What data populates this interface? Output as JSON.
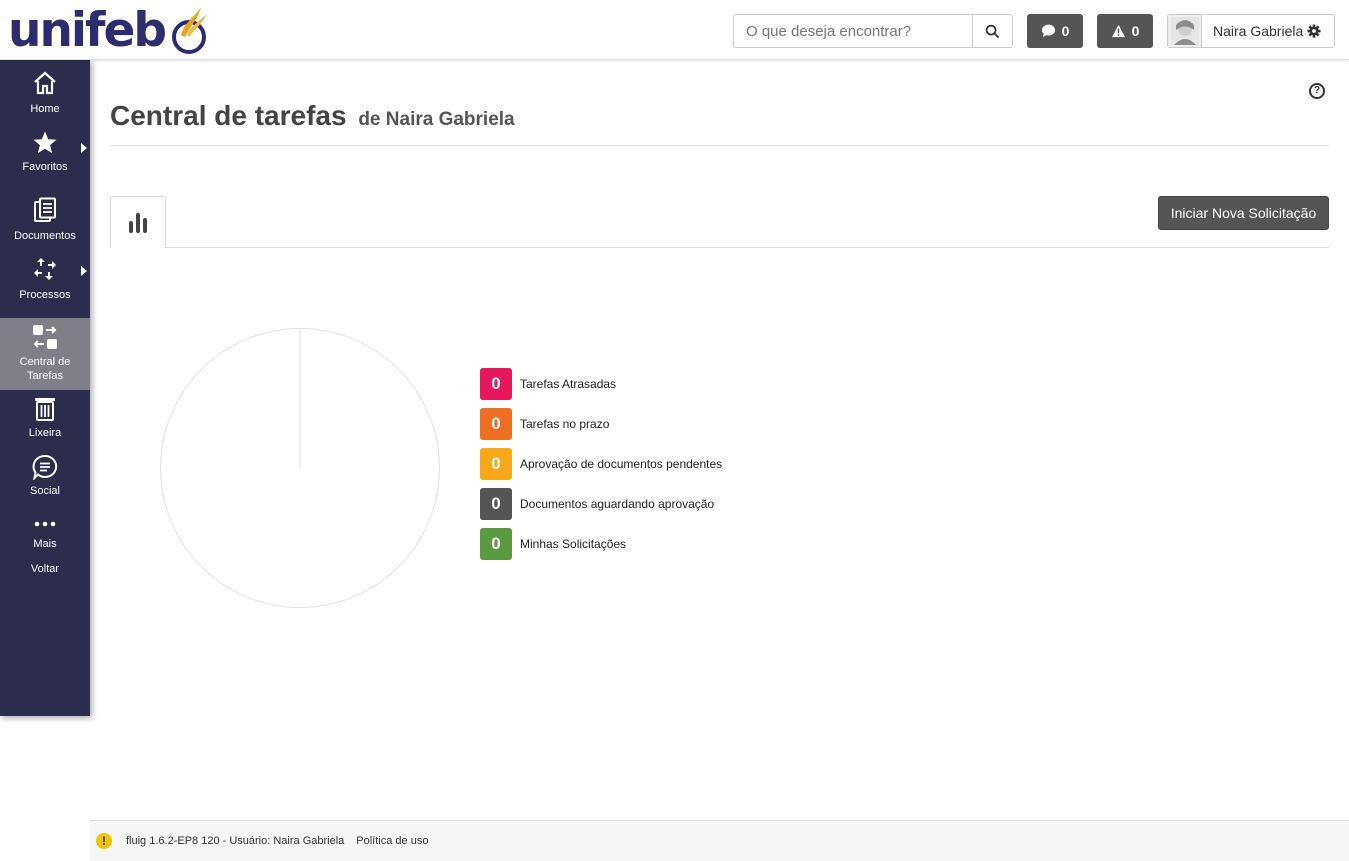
{
  "brand": {
    "logo_text": "unifeb",
    "color": "#2d2c6e",
    "accent": "#e8a31b"
  },
  "header": {
    "search": {
      "placeholder": "O que deseja encontrar?",
      "value": "",
      "icon": "search-icon"
    },
    "messages": {
      "icon": "chat-bubble-icon",
      "count": "0"
    },
    "alerts": {
      "icon": "warning-icon",
      "count": "0"
    },
    "user": {
      "name": "Naira Gabriela",
      "icon": "gear-icon"
    }
  },
  "sidebar": {
    "items": [
      {
        "label": "Home",
        "icon": "home-icon"
      },
      {
        "label": "Favoritos",
        "icon": "star-icon",
        "has_submenu": true
      },
      {
        "label": "Documentos",
        "icon": "documents-icon"
      },
      {
        "label": "Processos",
        "icon": "processes-icon",
        "has_submenu": true
      },
      {
        "label": "Central de Tarefas",
        "icon": "task-central-icon",
        "active": true
      },
      {
        "label": "Lixeira",
        "icon": "trash-icon"
      },
      {
        "label": "Social",
        "icon": "social-icon"
      },
      {
        "label": "Mais",
        "icon": "more-dots-icon"
      },
      {
        "label": "Voltar"
      }
    ]
  },
  "main": {
    "title": "Central de tarefas",
    "subtitle": "de Naira Gabriela",
    "help_label": "?",
    "tab_icon": "bar-chart-icon",
    "new_request_label": "Iniciar Nova Solicitação",
    "legend": [
      {
        "count": "0",
        "label": "Tarefas Atrasadas",
        "color": "#e8175d"
      },
      {
        "count": "0",
        "label": "Tarefas no prazo",
        "color": "#ee6e22"
      },
      {
        "count": "0",
        "label": "Aprovação de documentos pendentes",
        "color": "#f7a818"
      },
      {
        "count": "0",
        "label": "Documentos aguardando aprovação",
        "color": "#555555"
      },
      {
        "count": "0",
        "label": "Minhas Solicitações",
        "color": "#5b9a41"
      }
    ]
  },
  "chart_data": {
    "type": "pie",
    "categories": [
      "Tarefas Atrasadas",
      "Tarefas no prazo",
      "Aprovação de documentos pendentes",
      "Documentos aguardando aprovação",
      "Minhas Solicitações"
    ],
    "values": [
      0,
      0,
      0,
      0,
      0
    ]
  },
  "footer": {
    "version_text": "fluig 1.6.2-EP8 120 - Usuário: Naira Gabriela",
    "policy_link": "Política de uso",
    "icon": "warning-circle-icon"
  }
}
